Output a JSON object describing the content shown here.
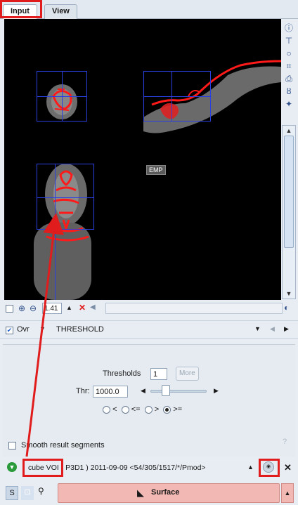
{
  "tabs": [
    {
      "label": "Input",
      "active": true
    },
    {
      "label": "View",
      "active": false
    }
  ],
  "viewer": {
    "badge": "EMP"
  },
  "zoom": {
    "value": "1.41"
  },
  "overlay": {
    "checkbox_label": "Ovr",
    "checked": true,
    "method": "THRESHOLD"
  },
  "thresholds": {
    "label": "Thresholds",
    "count": "1",
    "more_label": "More",
    "thr_label": "Thr:",
    "thr_value": "1000.0",
    "slider_fraction": 0.2,
    "operators": [
      {
        "label": "<",
        "selected": false
      },
      {
        "label": "<=",
        "selected": false
      },
      {
        "label": ">",
        "selected": false
      },
      {
        "label": ">=",
        "selected": true
      }
    ],
    "smooth_label": "Smooth result segments",
    "help": "?"
  },
  "voi": {
    "text": "cube VOI ( P3D1 ) 2011-09-09 <54/305/1517/*/Pmod>",
    "close": "✕"
  },
  "bottom": {
    "s_label": "S",
    "surface_label": "Surface"
  },
  "colors": {
    "highlight": "#e11c1c",
    "crosshair": "#2b3fe0",
    "surface_bg": "#f2b8b3"
  },
  "icons": [
    "info-icon",
    "network-icon",
    "ellipse-icon",
    "fit-icon",
    "print-icon",
    "brush-icon",
    "star-icon",
    "zoom-in-icon",
    "zoom-out-icon",
    "delete-icon",
    "go-icon",
    "lock-icon",
    "pin-icon",
    "surface-icon"
  ]
}
